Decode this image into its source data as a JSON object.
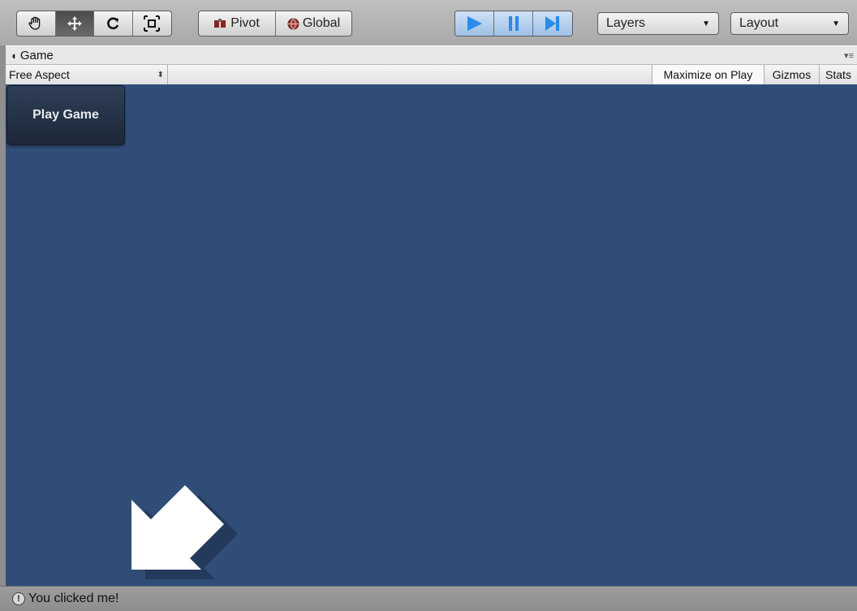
{
  "toolbar": {
    "tools": [
      {
        "icon": "hand-icon",
        "active": false
      },
      {
        "icon": "move-icon",
        "active": true
      },
      {
        "icon": "rotate-icon",
        "active": false
      },
      {
        "icon": "scale-icon",
        "active": false
      }
    ],
    "pivot_label": "Pivot",
    "global_label": "Global",
    "playback": {
      "play_active": true,
      "accent": "#2a8be8"
    },
    "layers_label": "Layers",
    "layout_label": "Layout"
  },
  "game_panel": {
    "tab_label": "Game",
    "aspect_label": "Free Aspect",
    "maximize_label": "Maximize on Play",
    "gizmos_label": "Gizmos",
    "stats_label": "Stats",
    "viewport_color": "#304d78",
    "play_button_label": "Play Game"
  },
  "status": {
    "message": "You clicked me!"
  }
}
